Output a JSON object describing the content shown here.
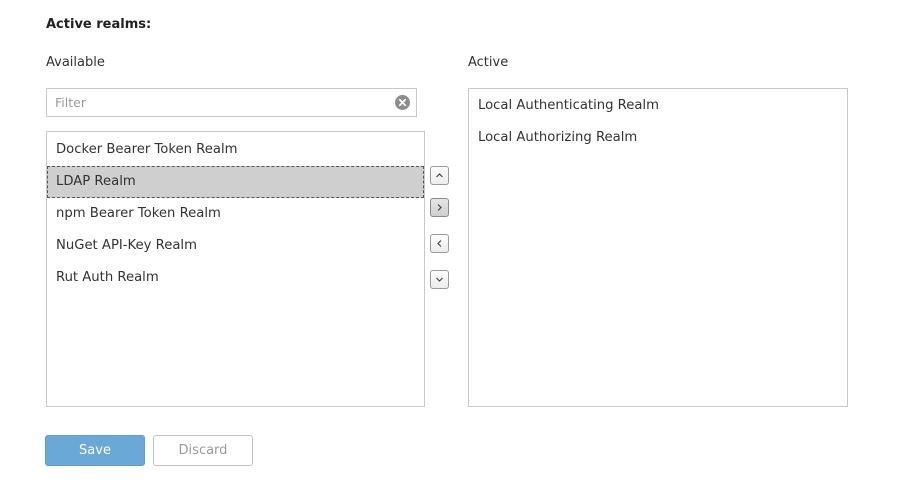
{
  "section": {
    "title": "Active realms:"
  },
  "available": {
    "label": "Available",
    "filter_placeholder": "Filter",
    "filter_value": "",
    "items": [
      {
        "label": "Docker Bearer Token Realm",
        "selected": false
      },
      {
        "label": "LDAP Realm",
        "selected": true
      },
      {
        "label": "npm Bearer Token Realm",
        "selected": false
      },
      {
        "label": "NuGet API-Key Realm",
        "selected": false
      },
      {
        "label": "Rut Auth Realm",
        "selected": false
      }
    ]
  },
  "active": {
    "label": "Active",
    "items": [
      {
        "label": "Local Authenticating Realm"
      },
      {
        "label": "Local Authorizing Realm"
      }
    ]
  },
  "move_buttons": [
    {
      "icon": "chevron-up-icon",
      "action": "move-up"
    },
    {
      "icon": "chevron-right-icon",
      "action": "add"
    },
    {
      "icon": "chevron-left-icon",
      "action": "remove"
    },
    {
      "icon": "chevron-down-icon",
      "action": "move-down"
    }
  ],
  "actions": {
    "save_label": "Save",
    "discard_label": "Discard"
  },
  "colors": {
    "save_button": "#6aa8d8",
    "selected_row": "#cfcfcf"
  }
}
